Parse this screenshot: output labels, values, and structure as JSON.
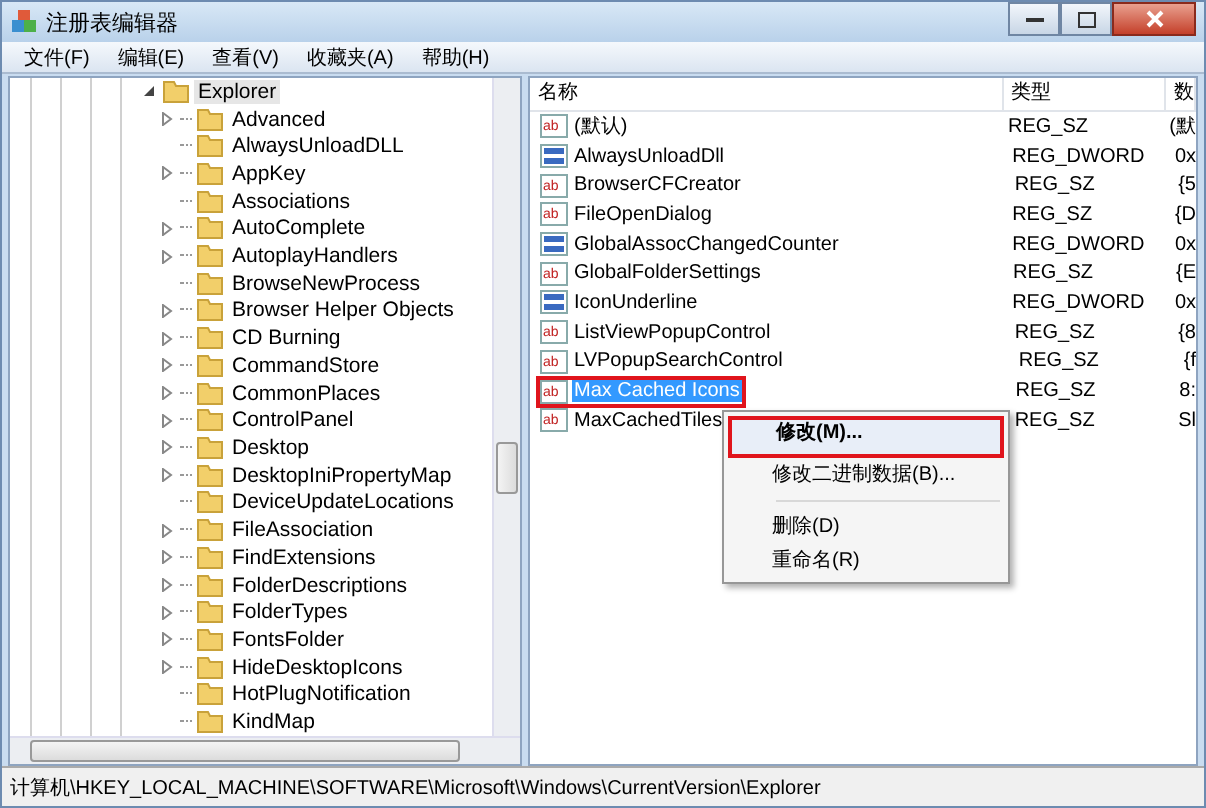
{
  "window": {
    "title": "注册表编辑器"
  },
  "menu": [
    "文件(F)",
    "编辑(E)",
    "查看(V)",
    "收藏夹(A)",
    "帮助(H)"
  ],
  "tree": {
    "label": "Explorer",
    "expanded": true,
    "selected": true,
    "children": [
      {
        "label": "Advanced",
        "expandable": true
      },
      {
        "label": "AlwaysUnloadDLL",
        "expandable": false
      },
      {
        "label": "AppKey",
        "expandable": true
      },
      {
        "label": "Associations",
        "expandable": false
      },
      {
        "label": "AutoComplete",
        "expandable": true
      },
      {
        "label": "AutoplayHandlers",
        "expandable": true
      },
      {
        "label": "BrowseNewProcess",
        "expandable": false
      },
      {
        "label": "Browser Helper Objects",
        "expandable": true
      },
      {
        "label": "CD Burning",
        "expandable": true
      },
      {
        "label": "CommandStore",
        "expandable": true
      },
      {
        "label": "CommonPlaces",
        "expandable": true
      },
      {
        "label": "ControlPanel",
        "expandable": true
      },
      {
        "label": "Desktop",
        "expandable": true
      },
      {
        "label": "DesktopIniPropertyMap",
        "expandable": true
      },
      {
        "label": "DeviceUpdateLocations",
        "expandable": false
      },
      {
        "label": "FileAssociation",
        "expandable": true
      },
      {
        "label": "FindExtensions",
        "expandable": true
      },
      {
        "label": "FolderDescriptions",
        "expandable": true
      },
      {
        "label": "FolderTypes",
        "expandable": true
      },
      {
        "label": "FontsFolder",
        "expandable": true
      },
      {
        "label": "HideDesktopIcons",
        "expandable": true
      },
      {
        "label": "HotPlugNotification",
        "expandable": false
      },
      {
        "label": "KindMap",
        "expandable": false
      }
    ]
  },
  "table": {
    "columns": [
      "名称",
      "类型",
      "数"
    ],
    "rows": [
      {
        "kind": "string",
        "icon_text": "ab",
        "name": "(默认)",
        "type": "REG_SZ",
        "column_3": "(默",
        "selected": false,
        "annotated": false
      },
      {
        "kind": "binary",
        "name": "AlwaysUnloadDll",
        "type": "REG_DWORD",
        "column_3": "0x",
        "selected": false,
        "annotated": false
      },
      {
        "kind": "string",
        "icon_text": "ab",
        "name": "BrowserCFCreator",
        "type": "REG_SZ",
        "column_3": "{5",
        "selected": false,
        "annotated": false
      },
      {
        "kind": "string",
        "icon_text": "ab",
        "name": "FileOpenDialog",
        "type": "REG_SZ",
        "column_3": "{D",
        "selected": false,
        "annotated": false
      },
      {
        "kind": "binary",
        "name": "GlobalAssocChangedCounter",
        "type": "REG_DWORD",
        "column_3": "0x",
        "selected": false,
        "annotated": false
      },
      {
        "kind": "string",
        "icon_text": "ab",
        "name": "GlobalFolderSettings",
        "type": "REG_SZ",
        "column_3": "{E",
        "selected": false,
        "annotated": false
      },
      {
        "kind": "binary",
        "name": "IconUnderline",
        "type": "REG_DWORD",
        "column_3": "0x",
        "selected": false,
        "annotated": false
      },
      {
        "kind": "string",
        "icon_text": "ab",
        "name": "ListViewPopupControl",
        "type": "REG_SZ",
        "column_3": "{8",
        "selected": false,
        "annotated": false
      },
      {
        "kind": "string",
        "icon_text": "ab",
        "name": "LVPopupSearchControl",
        "type": "REG_SZ",
        "column_3": "{f",
        "selected": false,
        "annotated": false
      },
      {
        "kind": "string",
        "icon_text": "ab",
        "name": "Max Cached Icons",
        "type": "REG_SZ",
        "column_3": "8:",
        "selected": true,
        "annotated": true
      },
      {
        "kind": "string",
        "icon_text": "ab",
        "name": "MaxCachedTiles",
        "type": "REG_SZ",
        "column_3": "Sl",
        "selected": false,
        "annotated": false
      }
    ]
  },
  "context_menu": [
    {
      "kind": "item",
      "label": "修改(M)...",
      "annotated": true
    },
    {
      "kind": "item",
      "label": "修改二进制数据(B)...",
      "annotated": false
    },
    {
      "kind": "separator"
    },
    {
      "kind": "item",
      "label": "删除(D)",
      "annotated": false
    },
    {
      "kind": "item",
      "label": "重命名(R)",
      "annotated": false
    }
  ],
  "status_bar": "计算机\\HKEY_LOCAL_MACHINE\\SOFTWARE\\Microsoft\\Windows\\CurrentVersion\\Explorer"
}
